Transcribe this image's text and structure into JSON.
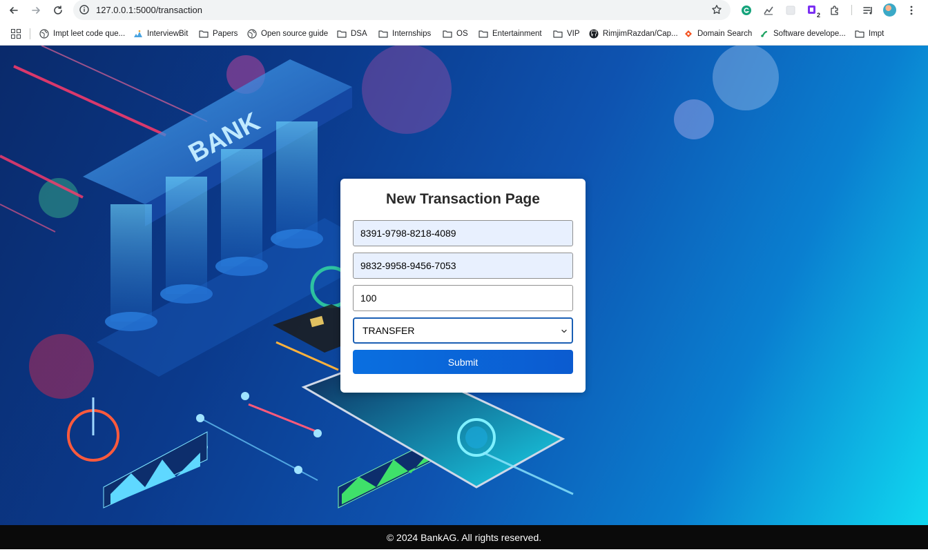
{
  "browser": {
    "url": "127.0.0.1:5000/transaction",
    "bookmarks": [
      {
        "label": "Impt leet code que...",
        "icon": "globe-icon"
      },
      {
        "label": "InterviewBit",
        "icon": "interviewbit-icon"
      },
      {
        "label": "Papers",
        "icon": "folder-icon"
      },
      {
        "label": "Open source guide",
        "icon": "globe-icon"
      },
      {
        "label": "DSA",
        "icon": "folder-icon"
      },
      {
        "label": "Internships",
        "icon": "folder-icon"
      },
      {
        "label": "OS",
        "icon": "folder-icon"
      },
      {
        "label": "Entertainment",
        "icon": "folder-icon"
      },
      {
        "label": "VIP",
        "icon": "folder-icon"
      },
      {
        "label": "RimjimRazdan/Cap...",
        "icon": "github-icon"
      },
      {
        "label": "Domain Search",
        "icon": "domain-search-icon"
      },
      {
        "label": "Software develope...",
        "icon": "software-icon"
      },
      {
        "label": "Impt",
        "icon": "folder-icon"
      }
    ],
    "extension_badge": "2"
  },
  "form": {
    "title": "New Transaction Page",
    "from_account": "8391-9798-8218-4089",
    "to_account": "9832-9958-9456-7053",
    "amount": "100",
    "transaction_type": "TRANSFER",
    "submit_label": "Submit"
  },
  "footer": {
    "text": "© 2024 BankAG. All rights reserved."
  },
  "colors": {
    "autofill_bg": "#e8f0fe",
    "submit_blue": "#0a6fe0",
    "footer_bg": "#0a0a0a"
  }
}
